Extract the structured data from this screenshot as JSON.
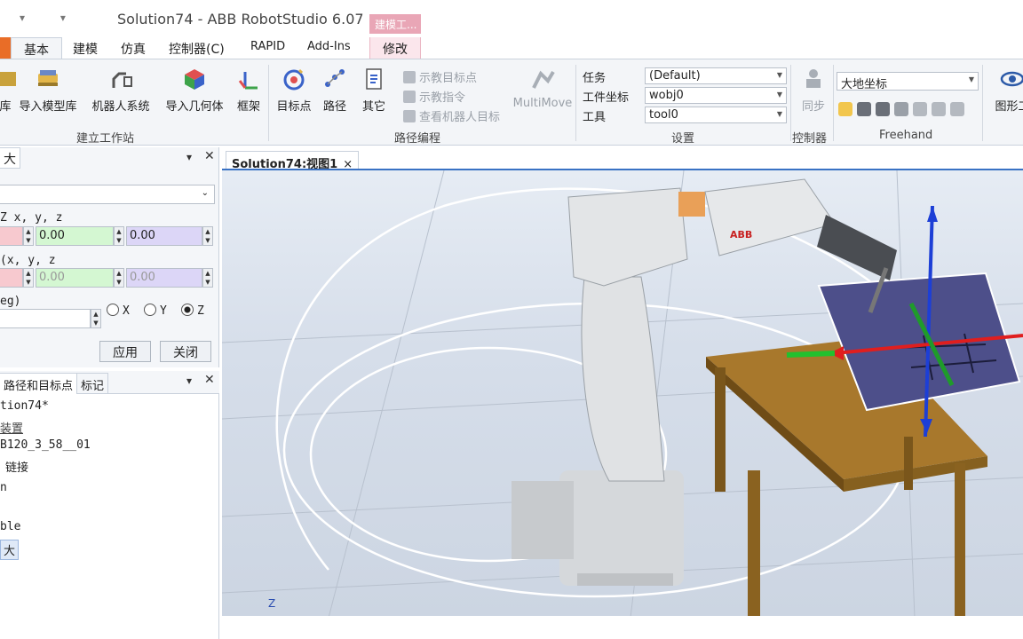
{
  "window": {
    "title": "Solution74 - ABB RobotStudio 6.07",
    "context_tab_header": "建模工..."
  },
  "tabs": [
    {
      "label": "基本"
    },
    {
      "label": "建模"
    },
    {
      "label": "仿真"
    },
    {
      "label": "控制器(C)"
    },
    {
      "label": "RAPID"
    },
    {
      "label": "Add-Ins"
    },
    {
      "label": "修改"
    }
  ],
  "ribbon": {
    "build_station": {
      "label": "建立工作站",
      "buttons": [
        "库",
        "导入模型库",
        "机器人系统",
        "导入几何体",
        "框架"
      ]
    },
    "path_programming": {
      "label": "路径编程",
      "buttons": [
        "目标点",
        "路径",
        "其它"
      ],
      "small_commands": [
        "示教目标点",
        "示教指令",
        "查看机器人目标"
      ],
      "multimove": "MultiMove"
    },
    "settings": {
      "label": "设置",
      "task_label": "任务",
      "task_value": "(Default)",
      "wobj_label": "工件坐标",
      "wobj_value": "wobj0",
      "tool_label": "工具",
      "tool_value": "tool0"
    },
    "controller": {
      "label": "控制器",
      "sync": "同步"
    },
    "freehand": {
      "label": "Freehand",
      "frame_value": "大地坐标"
    },
    "graphics": {
      "label": "图形工"
    }
  },
  "left_panel": {
    "tab_label": "大",
    "position_label": "Z x, y, z",
    "pos_values": [
      "",
      "0.00",
      "0.00"
    ],
    "rotation_label": "(x, y, z",
    "rot_values": [
      "",
      "0.00",
      "0.00"
    ],
    "angle_label": "eg)",
    "radio": {
      "x": "X",
      "y": "Y",
      "z": "Z",
      "selected": "Z"
    },
    "apply_button": "应用",
    "close_button": "关闭"
  },
  "tree_panel": {
    "tabs": [
      "路径和目标点",
      "标记"
    ],
    "items": [
      "tion74*",
      "装置",
      "B120_3_58__01",
      "链接",
      "n",
      "ble",
      "大"
    ]
  },
  "viewport": {
    "tab_label": "Solution74:视图1",
    "close": "×",
    "axis_label": "Z"
  },
  "colors": {
    "accent": "#3a72c4",
    "file_tab": "#e96d27",
    "context": "#e9a6b6",
    "pos_y_field": "#d4f7d2",
    "pos_z_field": "#dcd6f7",
    "pos_x_field": "#f7c9cf",
    "robot": "#dfe1e3",
    "table": "#a8782c",
    "workpiece": "#4d4f8a"
  }
}
